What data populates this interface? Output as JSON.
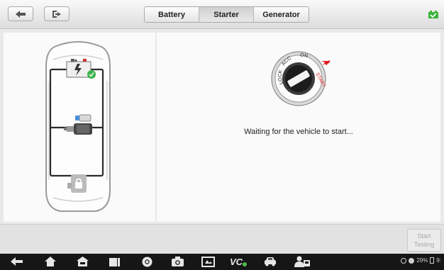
{
  "toolbar": {
    "back_icon": "back-arrow-icon",
    "exit_icon": "exit-icon",
    "tabs": [
      {
        "label": "Battery",
        "active": false
      },
      {
        "label": "Starter",
        "active": true
      },
      {
        "label": "Generator",
        "active": false
      }
    ],
    "vci_icon": "battery-connected-icon",
    "vci_color": "#3cb33c"
  },
  "main": {
    "status_message": "Waiting for the vehicle to start...",
    "ignition_labels": [
      "LOCK",
      "ACC",
      "ON",
      "START"
    ],
    "start_color": "#e02020",
    "battery_check_color": "#3cb34a"
  },
  "footer": {
    "start_button_label": "Start Testing",
    "start_button_enabled": false
  },
  "system_bar": {
    "icons": [
      "back-icon",
      "home-icon",
      "car-home-icon",
      "recent-apps-icon",
      "chrome-icon",
      "camera-icon",
      "screenshot-icon",
      "vci-icon",
      "vehicle-icon",
      "user-icon"
    ],
    "vci_text": "VC",
    "battery": "29%",
    "time": "9:"
  }
}
